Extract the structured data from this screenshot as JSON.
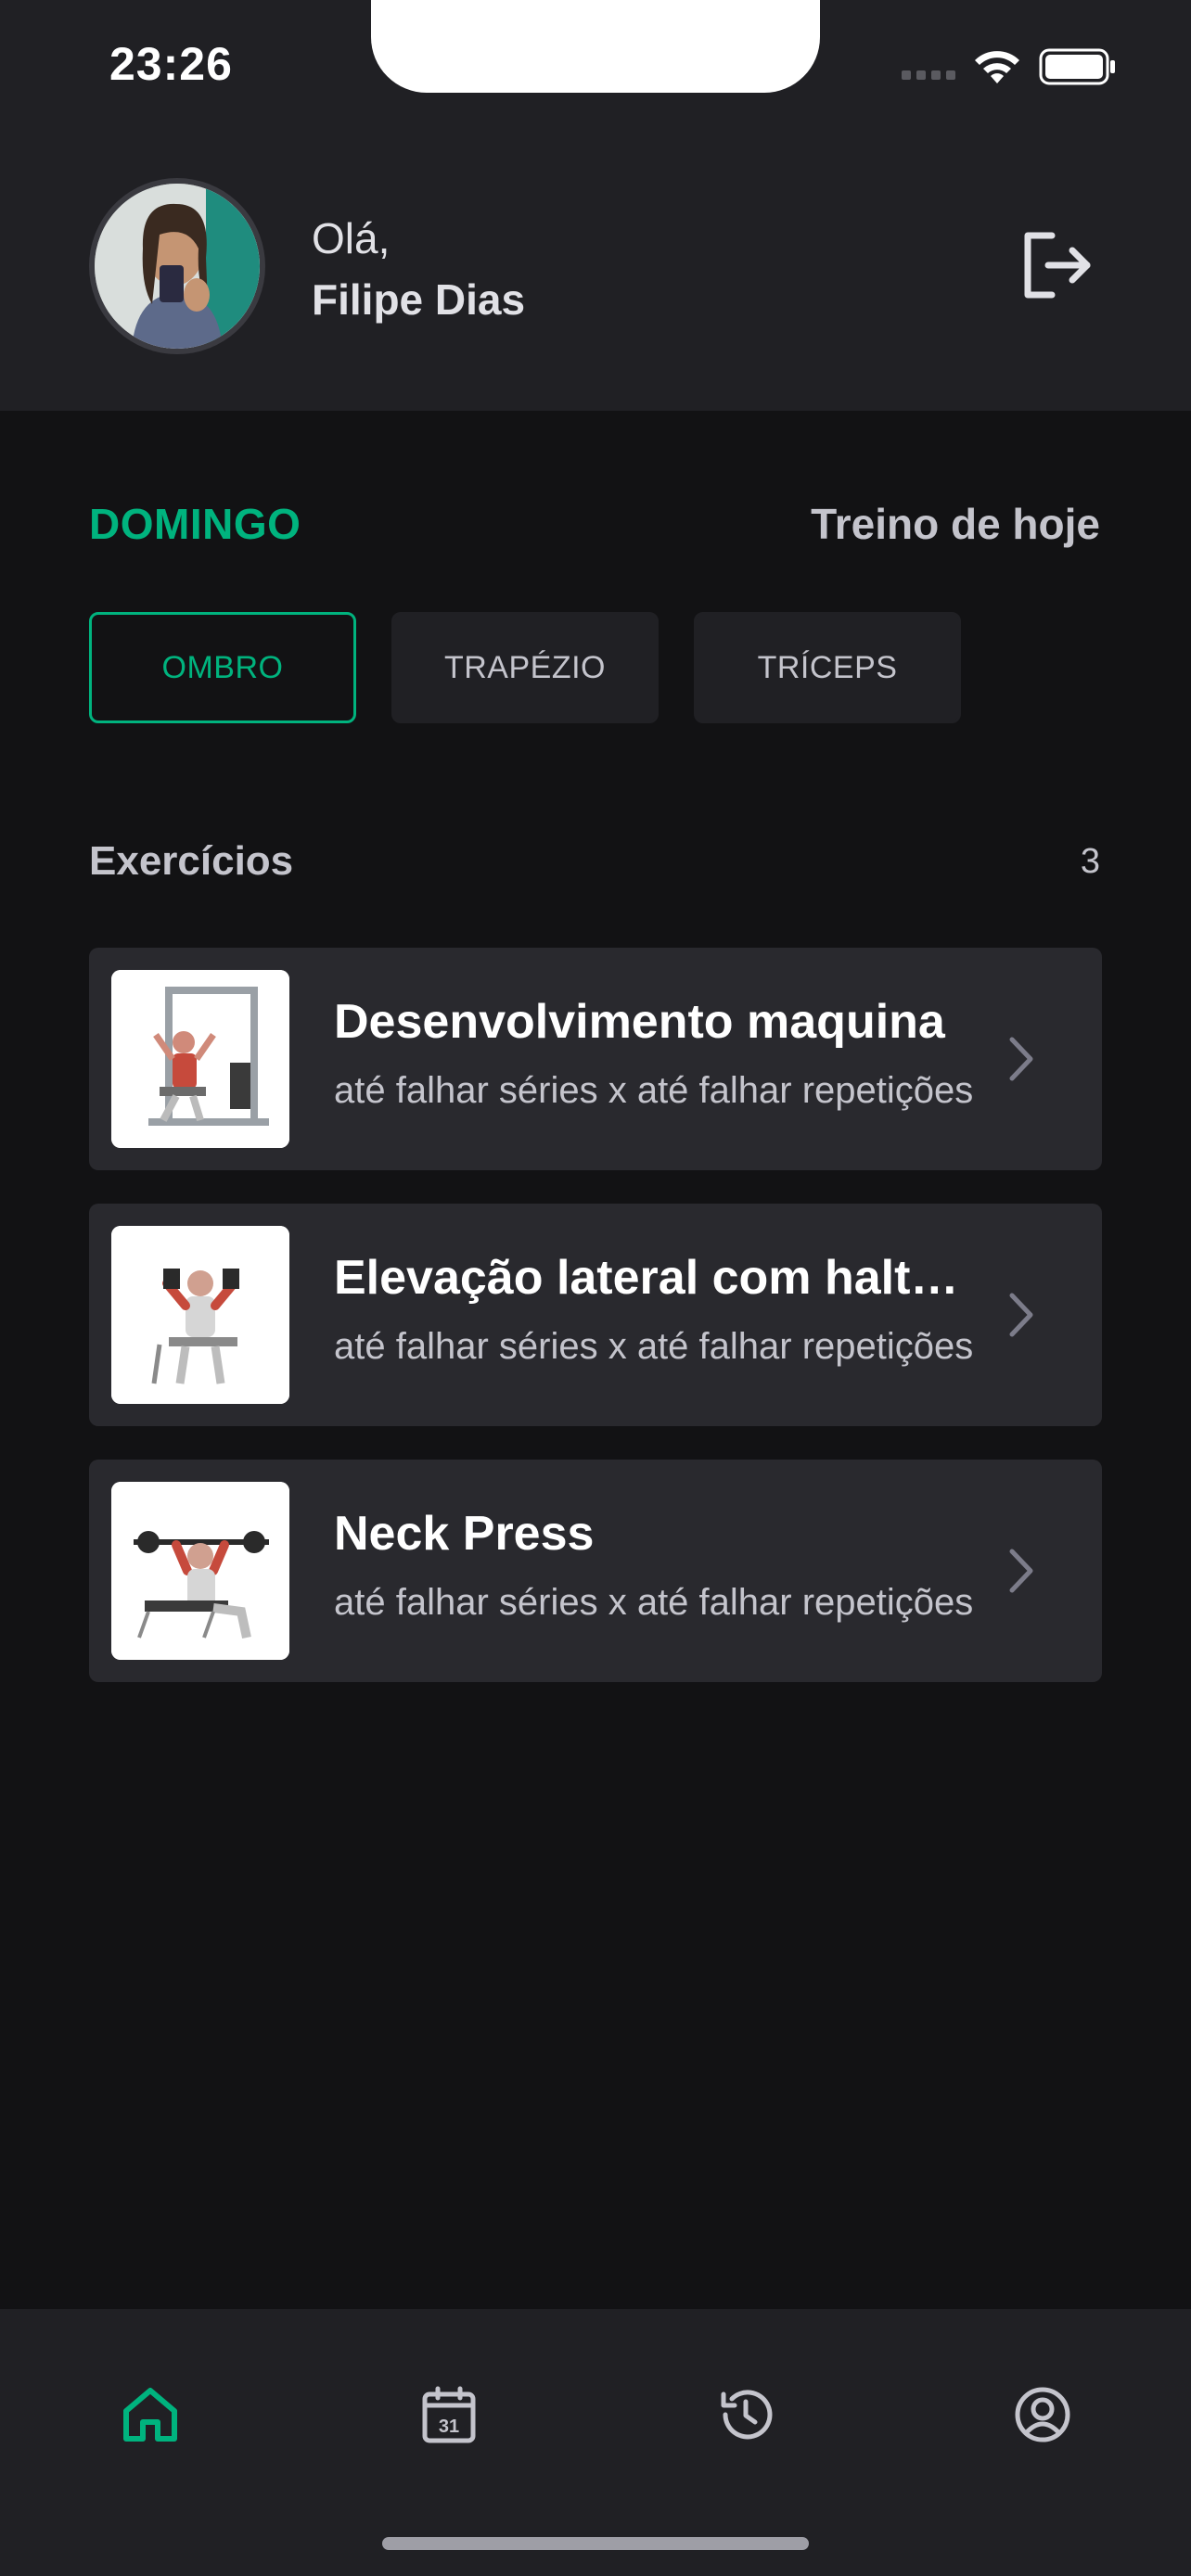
{
  "status_bar": {
    "time": "23:26"
  },
  "header": {
    "greeting": "Olá,",
    "user_name": "Filipe Dias"
  },
  "day": {
    "label": "DOMINGO",
    "today": "Treino de hoje"
  },
  "groups": [
    "OMBRO",
    "TRAPÉZIO",
    "TRÍCEPS"
  ],
  "exercises_header": {
    "title": "Exercícios",
    "count": "3"
  },
  "exercises": [
    {
      "name": "Desenvolvimento maquina",
      "details": "até falhar séries x até falhar repetições"
    },
    {
      "name": "Elevação lateral com halteres",
      "details": "até falhar séries x até falhar repetições"
    },
    {
      "name": "Neck Press",
      "details": "até falhar séries x até falhar repetições"
    }
  ],
  "tab_bar": {
    "items": [
      "home-icon",
      "calendar-icon",
      "history-icon",
      "profile-icon"
    ],
    "active": "home-icon",
    "calendar_day": "31"
  },
  "colors": {
    "accent": "#00B37E",
    "background": "#121214",
    "surface": "#202024",
    "card": "#29292E",
    "muted_text": "#C4C4CC"
  }
}
